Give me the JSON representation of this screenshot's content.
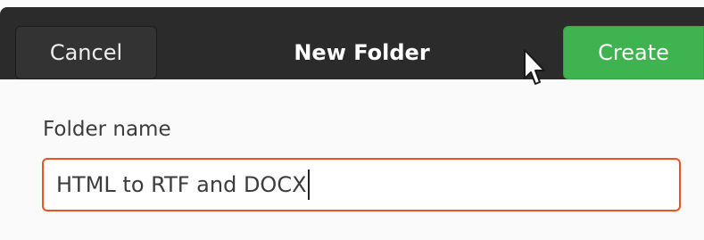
{
  "dialog": {
    "title": "New Folder",
    "cancel_label": "Cancel",
    "create_label": "Create"
  },
  "form": {
    "field_label": "Folder name",
    "folder_name_value": "HTML to RTF and DOCX"
  },
  "colors": {
    "headerbar_bg": "#2b2b2b",
    "create_button": "#3eb34f",
    "focus_border": "#e95420"
  },
  "icons": {
    "pointer": "mouse-pointer-icon"
  }
}
